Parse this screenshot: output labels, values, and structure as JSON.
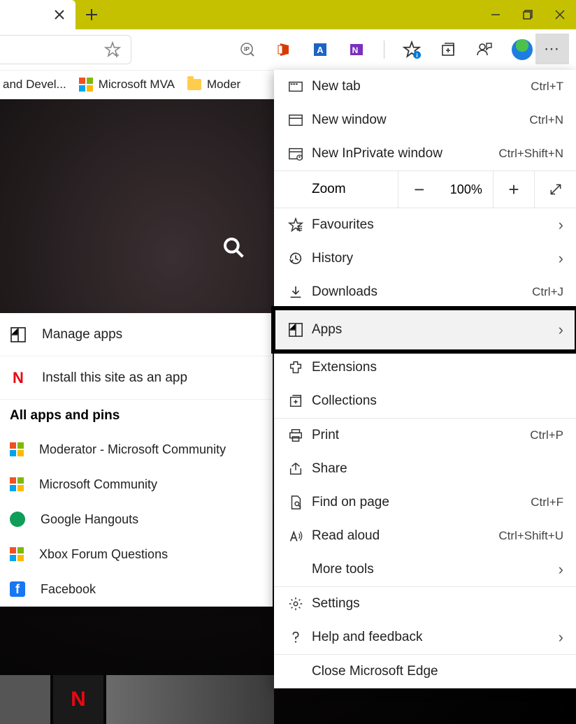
{
  "bookmarks": {
    "item1": "and Devel...",
    "item2": "Microsoft MVA",
    "item3": "Moder"
  },
  "apps_panel": {
    "manage": "Manage apps",
    "install": "Install this site as an app",
    "heading": "All apps and pins",
    "list": [
      "Moderator - Microsoft Community",
      "Microsoft Community",
      "Google Hangouts",
      "Xbox Forum Questions",
      "Facebook"
    ]
  },
  "menu": {
    "new_tab": "New tab",
    "new_tab_s": "Ctrl+T",
    "new_window": "New window",
    "new_window_s": "Ctrl+N",
    "inprivate": "New InPrivate window",
    "inprivate_s": "Ctrl+Shift+N",
    "zoom_label": "Zoom",
    "zoom_value": "100%",
    "favourites": "Favourites",
    "history": "History",
    "downloads": "Downloads",
    "downloads_s": "Ctrl+J",
    "apps": "Apps",
    "extensions": "Extensions",
    "collections": "Collections",
    "print": "Print",
    "print_s": "Ctrl+P",
    "share": "Share",
    "find": "Find on page",
    "find_s": "Ctrl+F",
    "read_aloud": "Read aloud",
    "read_aloud_s": "Ctrl+Shift+U",
    "more_tools": "More tools",
    "settings": "Settings",
    "help": "Help and feedback",
    "close_edge": "Close Microsoft Edge"
  }
}
